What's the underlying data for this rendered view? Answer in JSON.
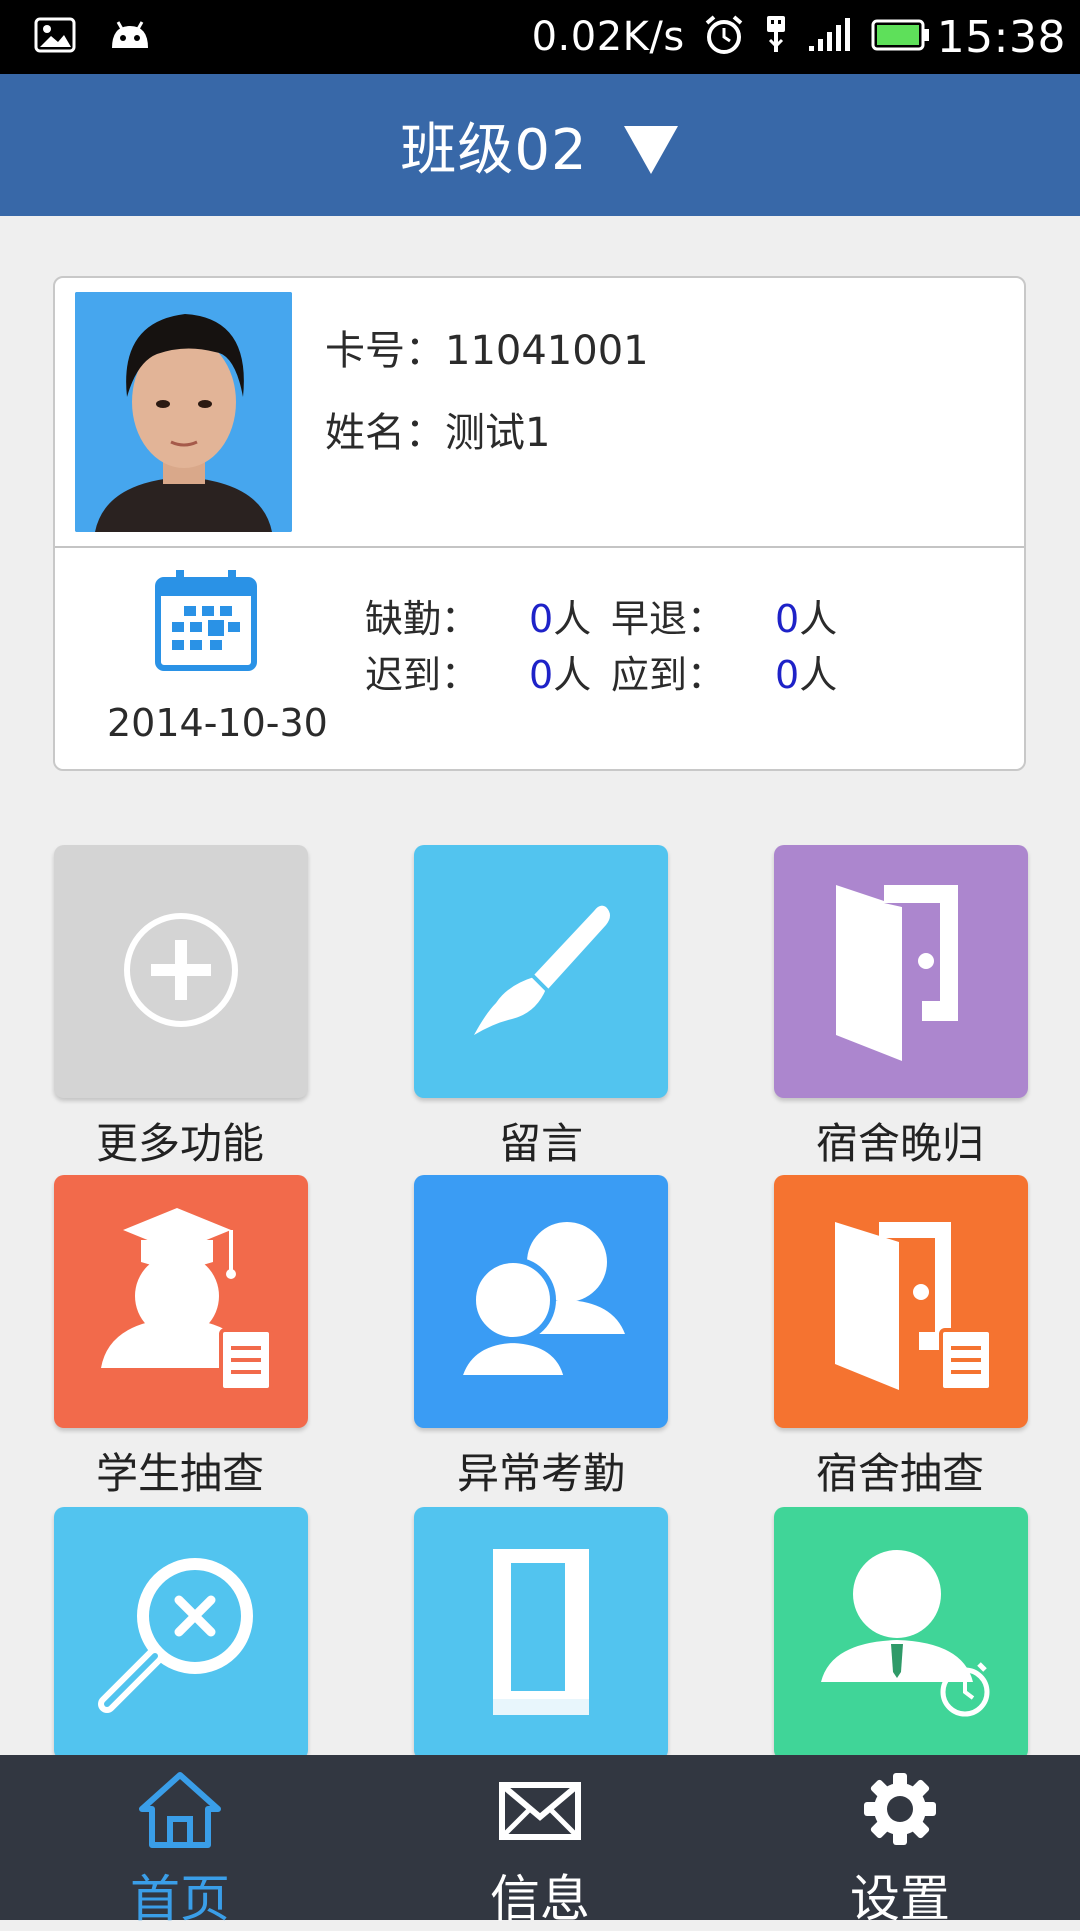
{
  "status_bar": {
    "speed": "0.02K/s",
    "time": "15:38",
    "icons": [
      "image-icon",
      "android-icon",
      "alarm-icon",
      "usb-icon",
      "signal-icon",
      "battery-icon"
    ]
  },
  "header": {
    "title": "班级02",
    "dropdown_icon": "triangle-down-icon"
  },
  "profile": {
    "card_label": "卡号：",
    "card_number": "11041001",
    "name_label": "姓名：",
    "name": "测试1",
    "date": "2014-10-30",
    "stats": {
      "absent_label": "缺勤：",
      "absent_value": "0",
      "leave_early_label": "早退：",
      "leave_early_value": "0",
      "late_label": "迟到：",
      "late_value": "0",
      "expected_label": "应到：",
      "expected_value": "0",
      "unit": "人"
    }
  },
  "tiles": [
    {
      "label": "更多功能",
      "color": "#d4d4d4",
      "icon": "plus-circle-icon"
    },
    {
      "label": "留言",
      "color": "#52c4ef",
      "icon": "paintbrush-icon"
    },
    {
      "label": "宿舍晚归",
      "color": "#ac86ce",
      "icon": "door-icon"
    },
    {
      "label": "学生抽查",
      "color": "#f26a4b",
      "icon": "graduate-icon"
    },
    {
      "label": "异常考勤",
      "color": "#3a9cf4",
      "icon": "people-icon"
    },
    {
      "label": "宿舍抽查",
      "color": "#f57330",
      "icon": "door-list-icon"
    },
    {
      "label": "",
      "color": "#52c4ef",
      "icon": "search-cancel-icon"
    },
    {
      "label": "",
      "color": "#52c4ef",
      "icon": "book-icon"
    },
    {
      "label": "",
      "color": "#40d598",
      "icon": "person-alarm-icon"
    }
  ],
  "tabbar": {
    "items": [
      {
        "label": "首页",
        "icon": "home-icon",
        "active": true
      },
      {
        "label": "信息",
        "icon": "envelope-icon",
        "active": false
      },
      {
        "label": "设置",
        "icon": "gear-icon",
        "active": false
      }
    ],
    "active_color": "#3a9ee8",
    "inactive_color": "#ffffff"
  }
}
